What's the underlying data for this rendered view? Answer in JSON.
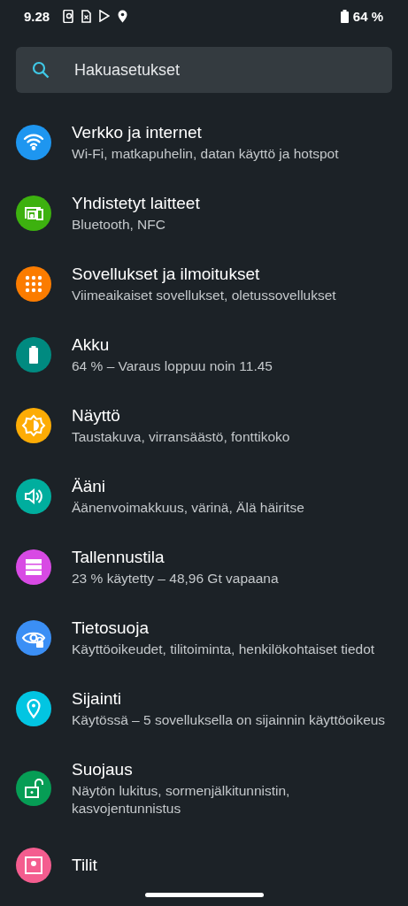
{
  "status_bar": {
    "time": "9.28",
    "battery": "64 %"
  },
  "search": {
    "placeholder": "Hakuasetukset"
  },
  "items": [
    {
      "kind": "wifi",
      "color": "#1e96f0",
      "title": "Verkko ja internet",
      "subtitle": "Wi-Fi, matkapuhelin, datan käyttö ja hotspot"
    },
    {
      "kind": "devices",
      "color": "#3db10f",
      "title": "Yhdistetyt laitteet",
      "subtitle": "Bluetooth, NFC"
    },
    {
      "kind": "apps",
      "color": "#fb7c00",
      "title": "Sovellukset ja ilmoitukset",
      "subtitle": "Viimeaikaiset sovellukset, oletussovellukset"
    },
    {
      "kind": "battery",
      "color": "#008a80",
      "title": "Akku",
      "subtitle": "64 % – Varaus loppuu noin 11.45"
    },
    {
      "kind": "display",
      "color": "#fdac05",
      "title": "Näyttö",
      "subtitle": "Taustakuva, virransäästö, fonttikoko"
    },
    {
      "kind": "sound",
      "color": "#00ae9e",
      "title": "Ääni",
      "subtitle": "Äänenvoimakkuus, värinä, Älä häiritse"
    },
    {
      "kind": "storage",
      "color": "#d84ae4",
      "title": "Tallennustila",
      "subtitle": "23 % käytetty – 48,96 Gt vapaana"
    },
    {
      "kind": "privacy",
      "color": "#3b8ff5",
      "title": "Tietosuoja",
      "subtitle": "Käyttöoikeudet, tilitoiminta, henkilökohtaiset tiedot"
    },
    {
      "kind": "location",
      "color": "#02c5e2",
      "title": "Sijainti",
      "subtitle": "Käytössä – 5 sovelluksella on sijainnin käyttöoikeus"
    },
    {
      "kind": "security",
      "color": "#069d55",
      "title": "Suojaus",
      "subtitle": "Näytön lukitus, sormenjälkitunnistin, kasvojentunnistus"
    },
    {
      "kind": "accounts",
      "color": "#f45d8f",
      "title": "Tilit"
    }
  ]
}
